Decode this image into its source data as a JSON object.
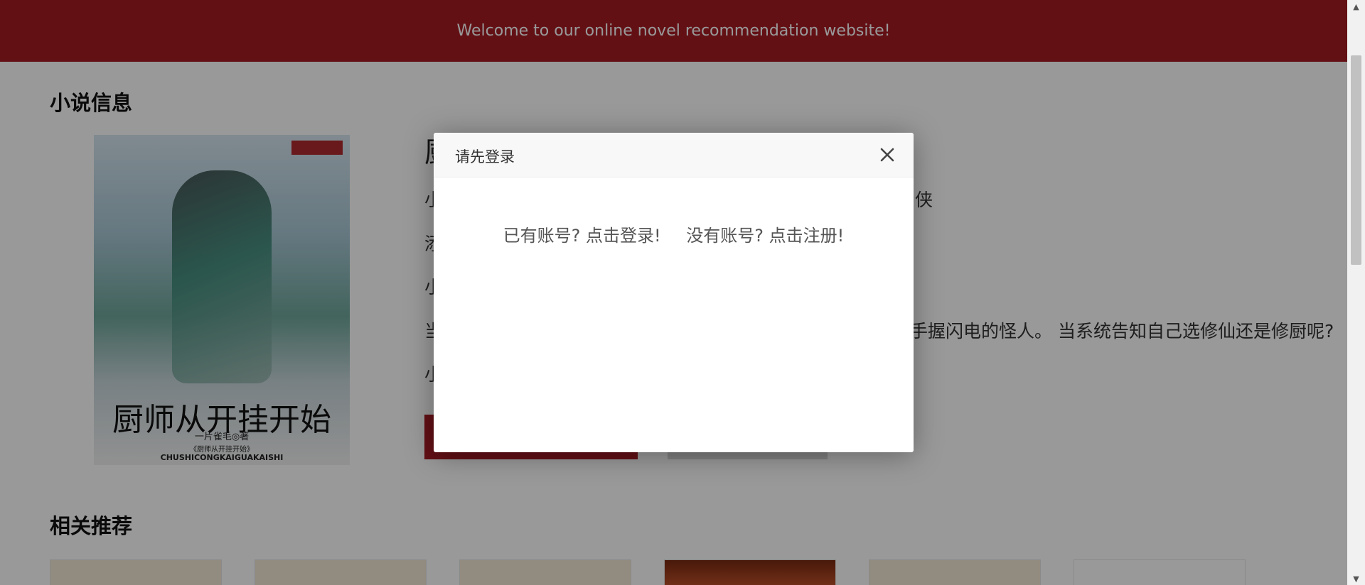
{
  "banner": {
    "text": "Welcome to our online novel recommendation website!"
  },
  "sections": {
    "novel_info": "小说信息",
    "related": "相关推荐"
  },
  "novel": {
    "title_partial": "厨",
    "row_category_partial": "小",
    "row_category_tail": "侠",
    "row_2_partial": "添",
    "row_3_partial": "小",
    "row_summary_partial": "当",
    "row_summary_tail": "手握闪电的怪人。 当系统告知自己选修仙还是修厨呢?",
    "row_5_partial": "小"
  },
  "cover": {
    "title": "厨师从开挂开始",
    "author": "一片雀毛◎著",
    "subtitle": "《厨师从开挂开始》",
    "pinyin": "CHUSHICONGKAIGUAKAISHI"
  },
  "modal": {
    "title": "请先登录",
    "login_text": "已有账号? 点击登录!",
    "register_text": "没有账号? 点击注册!"
  },
  "colors": {
    "brand": "#a51c24",
    "overlay": "rgba(0,0,0,0.40)"
  }
}
